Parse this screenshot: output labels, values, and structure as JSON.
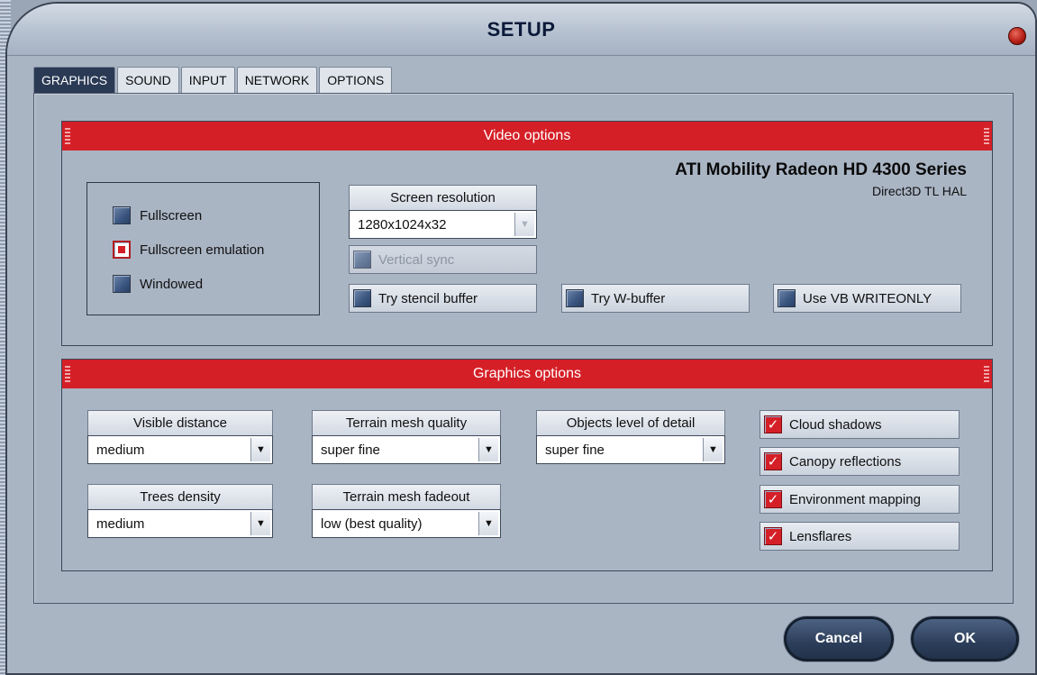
{
  "window": {
    "title": "SETUP"
  },
  "tabs": [
    {
      "label": "GRAPHICS",
      "active": true
    },
    {
      "label": "SOUND",
      "active": false
    },
    {
      "label": "INPUT",
      "active": false
    },
    {
      "label": "NETWORK",
      "active": false
    },
    {
      "label": "OPTIONS",
      "active": false
    }
  ],
  "video": {
    "header": "Video options",
    "gpu_name": "ATI Mobility Radeon HD 4300 Series",
    "gpu_api": "Direct3D TL HAL",
    "modes": [
      {
        "label": "Fullscreen",
        "selected": false
      },
      {
        "label": "Fullscreen emulation",
        "selected": true
      },
      {
        "label": "Windowed",
        "selected": false
      }
    ],
    "resolution": {
      "label": "Screen resolution",
      "value": "1280x1024x32"
    },
    "vertical_sync": {
      "label": "Vertical sync",
      "checked": false,
      "enabled": false
    },
    "stencil": {
      "label": "Try stencil buffer",
      "checked": false
    },
    "wbuffer": {
      "label": "Try W-buffer",
      "checked": false
    },
    "vb_writeonly": {
      "label": "Use VB WRITEONLY",
      "checked": false
    }
  },
  "graphics": {
    "header": "Graphics options",
    "visible_distance": {
      "label": "Visible distance",
      "value": "medium"
    },
    "trees_density": {
      "label": "Trees density",
      "value": "medium"
    },
    "terrain_quality": {
      "label": "Terrain mesh quality",
      "value": "super fine"
    },
    "terrain_fadeout": {
      "label": "Terrain mesh fadeout",
      "value": "low (best quality)"
    },
    "objects_lod": {
      "label": "Objects level of detail",
      "value": "super fine"
    },
    "cloud_shadows": {
      "label": "Cloud shadows",
      "checked": true
    },
    "canopy_reflections": {
      "label": "Canopy reflections",
      "checked": true
    },
    "environment_mapping": {
      "label": "Environment mapping",
      "checked": true
    },
    "lensflares": {
      "label": "Lensflares",
      "checked": true
    }
  },
  "buttons": {
    "cancel": "Cancel",
    "ok": "OK"
  },
  "colors": {
    "header_red": "#d51f27",
    "panel": "#aab5c4",
    "active_tab": "#2a3a55"
  },
  "icons": {
    "check": "✓",
    "dropdown": "▼"
  }
}
